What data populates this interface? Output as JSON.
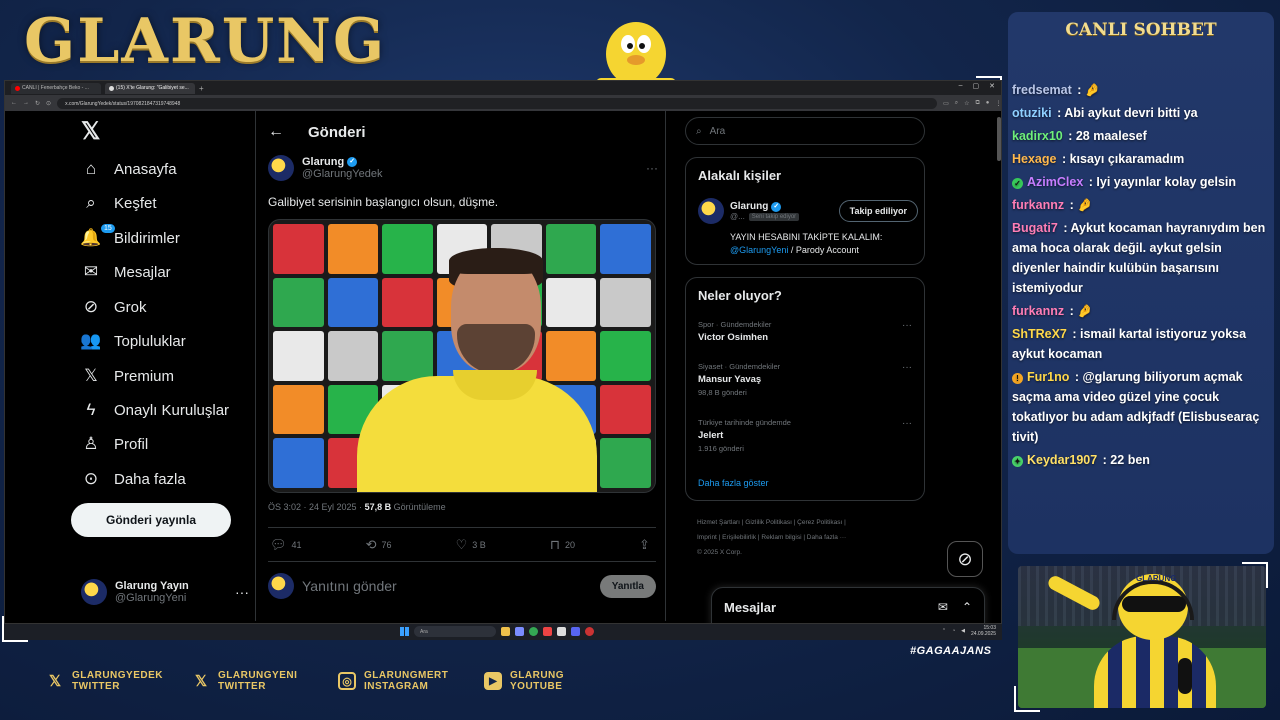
{
  "overlay": {
    "brand": "GLARUNG",
    "hashtag": "#GAGAAJANS",
    "socials": [
      {
        "icon": "x-icon",
        "line1": "GLARUNGYEDEK",
        "line2": "TWITTER"
      },
      {
        "icon": "x-icon",
        "line1": "GLARUNGYENI",
        "line2": "TWITTER"
      },
      {
        "icon": "instagram-icon",
        "line1": "GLARUNGMERT",
        "line2": "INSTAGRAM"
      },
      {
        "icon": "youtube-icon",
        "line1": "GLARUNG",
        "line2": "YOUTUBE"
      }
    ],
    "accent_color": "#e9c765"
  },
  "browser": {
    "tabs": [
      {
        "label": "CANLI | Fenerbahçe Beko - ...",
        "active": false
      },
      {
        "label": "(15) X'te Glarung: \"Galibiyet se...",
        "active": true
      }
    ],
    "new_tab": "+",
    "url": "x.com/GlarungYedek/status/1970821847319748948"
  },
  "nav": {
    "items": [
      {
        "icon": "home-icon",
        "glyph": "⌂",
        "label": "Anasayfa"
      },
      {
        "icon": "search-icon",
        "glyph": "⌕",
        "label": "Keşfet"
      },
      {
        "icon": "bell-icon",
        "glyph": "🔔",
        "label": "Bildirimler",
        "badge": "15"
      },
      {
        "icon": "mail-icon",
        "glyph": "✉",
        "label": "Mesajlar"
      },
      {
        "icon": "grok-icon",
        "glyph": "⊘",
        "label": "Grok"
      },
      {
        "icon": "communities-icon",
        "glyph": "👥",
        "label": "Topluluklar"
      },
      {
        "icon": "x-premium-icon",
        "glyph": "𝕏",
        "label": "Premium"
      },
      {
        "icon": "lightning-icon",
        "glyph": "ϟ",
        "label": "Onaylı Kuruluşlar"
      },
      {
        "icon": "profile-icon",
        "glyph": "♙",
        "label": "Profil"
      },
      {
        "icon": "more-circle-icon",
        "glyph": "⊙",
        "label": "Daha fazla"
      }
    ],
    "post_button": "Gönderi yayınla",
    "account": {
      "name": "Glarung Yayın",
      "handle": "@GlarungYeni"
    }
  },
  "post": {
    "header_title": "Gönderi",
    "author_name": "Glarung",
    "author_handle": "@GlarungYedek",
    "text": "Galibiyet serisinin başlangıcı olsun, düşme.",
    "meta_time": "ÖS 3:02 · 24 Eyl 2025 · ",
    "views_count": "57,8 B",
    "views_label": " Görüntüleme",
    "replies": "41",
    "reposts": "76",
    "likes": "3 B",
    "bookmarks": "20",
    "reply_placeholder": "Yanıtını gönder",
    "reply_button": "Yanıtla"
  },
  "sidebar": {
    "search_placeholder": "Ara",
    "related_title": "Alakalı kişiler",
    "related_user": {
      "name": "Glarung",
      "handle": "@...",
      "follows_you": "Seni takip ediyor",
      "follow_button": "Takip ediliyor",
      "bio_text": "YAYIN HESABINI TAKİPTE KALALIM:",
      "bio_link": "@GlarungYeni",
      "bio_suffix": " / Parody Account"
    },
    "trending_title": "Neler oluyor?",
    "trends": [
      {
        "meta": "Spor · Gündemdekiler",
        "name": "Victor Osimhen",
        "count": ""
      },
      {
        "meta": "Siyaset · Gündemdekiler",
        "name": "Mansur Yavaş",
        "count": "98,8 B gönderi"
      },
      {
        "meta": "Türkiye tarihinde gündemde",
        "name": "Jelert",
        "count": "1.916 gönderi"
      }
    ],
    "show_more": "Daha fazla göster",
    "footer_line1": "Hizmet Şartları  |  Gizlilik Politikası  |  Çerez Politikası  |",
    "footer_line2": "Imprint  |  Erişilebilirlik  |  Reklam bilgisi  |  Daha fazla ···",
    "footer_line3": "© 2025 X Corp.",
    "messages_drawer": "Mesajlar"
  },
  "taskbar": {
    "search": "Ara",
    "time": "15:03",
    "date": "24.09.2025"
  },
  "chat": {
    "title": "CANLI SOHBET",
    "messages": [
      {
        "user": "fredsemat",
        "color": "#b9c6e8",
        "text": " : 🤌",
        "badge": ""
      },
      {
        "user": "otuziki",
        "color": "#8fd0ff",
        "text": " : Abi aykut devri bitti ya",
        "badge": ""
      },
      {
        "user": "kadirx10",
        "color": "#6ef07a",
        "text": " : 28 maalesef",
        "badge": ""
      },
      {
        "user": "Hexage",
        "color": "#ffb84d",
        "text": " : kısayı çıkaramadım",
        "badge": ""
      },
      {
        "user": "AzimClex",
        "color": "#c77dff",
        "text": " : Iyi yayınlar kolay gelsin",
        "badge": "✓"
      },
      {
        "user": "furkannz",
        "color": "#ff7eb6",
        "text": " : 🤌",
        "badge": ""
      },
      {
        "user": "Bugati7",
        "color": "#ff7eb6",
        "text": " : Aykut kocaman hayranıydım ben ama hoca olarak değil. aykut gelsin diyenler haindir kulübün başarısını istemiyodur",
        "badge": ""
      },
      {
        "user": "furkannz",
        "color": "#ff7eb6",
        "text": " : 🤌",
        "badge": ""
      },
      {
        "user": "ShTReX7",
        "color": "#ffd84a",
        "text": " : ismail kartal istiyoruz yoksa aykut kocaman",
        "badge": ""
      },
      {
        "user": "Fur1no",
        "color": "#ffd84a",
        "text": " : @glarung biliyorum açmak saçma ama video güzel yine çocuk tokatlıyor bu adam adkjfadf (Elisbusearaç tivit)",
        "badge": "!"
      },
      {
        "user": "Keydar1907",
        "color": "#ffe066",
        "text": " : 22 ben",
        "badge": "✦"
      }
    ]
  },
  "cam": {
    "cap_text": "GLARUNG"
  }
}
